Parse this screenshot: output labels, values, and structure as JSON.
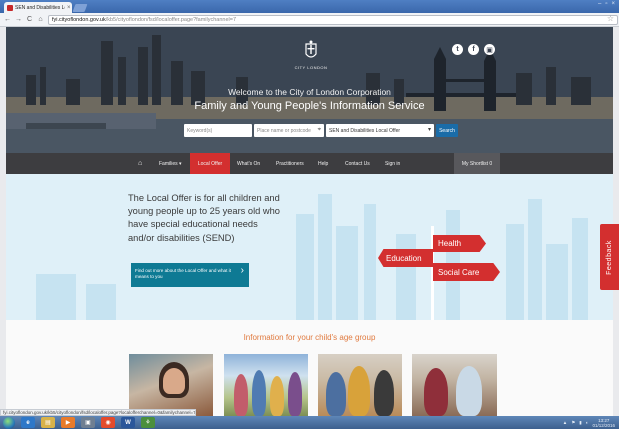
{
  "browser": {
    "tab_title": "SEN and Disabilities Local",
    "tab_close": "×",
    "window_controls": [
      "–",
      "▫",
      "×"
    ],
    "back": "←",
    "forward": "→",
    "reload": "C",
    "home": "⌂",
    "url_host": "fyi.cityoflondon.gov.uk",
    "url_path": "/kb5/cityoflondon/fsd/localoffer.page?familychannel=7",
    "bookmark": "☆",
    "status_url": "fyi.cityoflondon.gov.uk/kb5/cityoflondon/fsd/localoffer.page?localofferchannel=0&familychannel=7"
  },
  "hero": {
    "crest_label": "CITY LONDON",
    "line1": "Welcome to the City of London Corporation",
    "line2": "Family and Young People's Information Service",
    "social": [
      "t",
      "f",
      "▣"
    ],
    "search": {
      "keyword_placeholder": "Keyword(s)",
      "postcode_placeholder": "Place name or postcode",
      "pin": "⌖",
      "category": "SEN and Disabilities Local Offer",
      "caret": "▾",
      "button": "Search"
    }
  },
  "nav": {
    "home": "⌂",
    "families": "Families ▾",
    "local_offer": "Local Offer",
    "whats_on": "What's On",
    "practitioners": "Practitioners",
    "help": "Help",
    "contact": "Contact Us",
    "sign_in": "Sign in",
    "shortlist": "My Shortlist 0"
  },
  "banner": {
    "intro": "The Local Offer is for all children and young people up to 25 years old who have special educational needs and/or disabilities (SEND)",
    "cta": "Find out more about the Local Offer and what it means to you",
    "cta_arrow": "›",
    "signs": {
      "health": "Health",
      "education": "Education",
      "social_care": "Social Care"
    },
    "feedback": "Feedback"
  },
  "age_section": {
    "title": "Information for your child's age group"
  },
  "taskbar": {
    "items": [
      "e",
      "▤",
      "▶",
      "▣",
      "◉",
      "W",
      "⚘"
    ],
    "tray": [
      "▲",
      "⚑",
      "▮",
      "◐"
    ],
    "clock_time": "13:27",
    "clock_date": "01/12/2016"
  },
  "colors": {
    "brand_red": "#d32f2f",
    "nav_dark": "#3d3d40",
    "teal": "#0e7a94",
    "search_blue": "#1a6ca8",
    "age_title": "#e07a3f",
    "banner_bg": "#dff0f8"
  }
}
